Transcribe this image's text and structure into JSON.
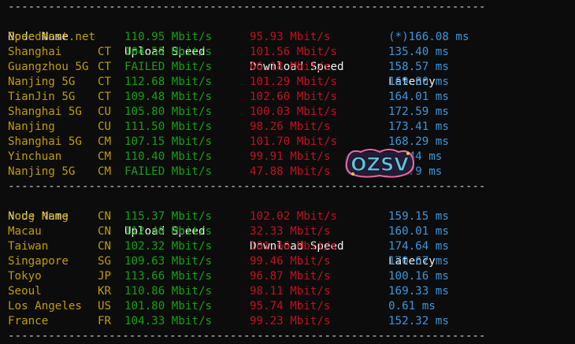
{
  "divider": "------------------------------------------------------------------------------------------",
  "headers": {
    "node": "Node Name",
    "upload": "Upload Speed",
    "download": "Download Speed",
    "latency": "Latency"
  },
  "table1": [
    {
      "node": "Speedtest.net",
      "isp": "",
      "up": "110.95 Mbit/s",
      "down": "95.93 Mbit/s",
      "lat": "(*)166.08 ms"
    },
    {
      "node": "Shanghai",
      "isp": "CT",
      "up": "104.58 Mbit/s",
      "down": "101.56 Mbit/s",
      "lat": "135.40 ms"
    },
    {
      "node": "Guangzhou 5G",
      "isp": "CT",
      "up": "FAILED Mbit/s",
      "down": "66.18 Mbit/s",
      "lat": "158.57 ms"
    },
    {
      "node": "Nanjing 5G",
      "isp": "CT",
      "up": "112.68 Mbit/s",
      "down": "101.29 Mbit/s",
      "lat": "169.80 ms"
    },
    {
      "node": "TianJin 5G",
      "isp": "CT",
      "up": "109.48 Mbit/s",
      "down": "102.60 Mbit/s",
      "lat": "164.01 ms"
    },
    {
      "node": "Shanghai 5G",
      "isp": "CU",
      "up": "105.80 Mbit/s",
      "down": "100.03 Mbit/s",
      "lat": "172.59 ms"
    },
    {
      "node": "Nanjing",
      "isp": "CU",
      "up": "111.50 Mbit/s",
      "down": "98.26 Mbit/s",
      "lat": "173.41 ms"
    },
    {
      "node": "Shanghai 5G",
      "isp": "CM",
      "up": "107.15 Mbit/s",
      "down": "101.70 Mbit/s",
      "lat": "168.29 ms"
    },
    {
      "node": "Yinchuan",
      "isp": "CM",
      "up": "110.40 Mbit/s",
      "down": "99.91 Mbit/s",
      "lat": "   44 ms"
    },
    {
      "node": "Nanjing 5G",
      "isp": "CM",
      "up": "FAILED Mbit/s",
      "down": "47.88 Mbit/s",
      "lat": "   79 ms"
    }
  ],
  "table2": [
    {
      "node": "Hong Kong",
      "isp": "CN",
      "up": "115.37 Mbit/s",
      "down": "102.02 Mbit/s",
      "lat": "159.15 ms"
    },
    {
      "node": "Macau",
      "isp": "CN",
      "up": "112.40 Mbit/s",
      "down": "32.33 Mbit/s",
      "lat": "160.01 ms"
    },
    {
      "node": "Taiwan",
      "isp": "CN",
      "up": "102.32 Mbit/s",
      "down": "101.66 Mbit/s",
      "lat": "174.64 ms"
    },
    {
      "node": "Singapore",
      "isp": "SG",
      "up": "109.63 Mbit/s",
      "down": "99.46 Mbit/s",
      "lat": "170.67 ms"
    },
    {
      "node": "Tokyo",
      "isp": "JP",
      "up": "113.66 Mbit/s",
      "down": "96.87 Mbit/s",
      "lat": "100.16 ms"
    },
    {
      "node": "Seoul",
      "isp": "KR",
      "up": "110.86 Mbit/s",
      "down": "98.11 Mbit/s",
      "lat": "169.33 ms"
    },
    {
      "node": "Los Angeles",
      "isp": "US",
      "up": "101.80 Mbit/s",
      "down": "95.74 Mbit/s",
      "lat": "0.61 ms"
    },
    {
      "node": "France",
      "isp": "FR",
      "up": "104.33 Mbit/s",
      "down": "99.23 Mbit/s",
      "lat": "152.32 ms"
    }
  ],
  "watermark": {
    "text": "OZSV",
    "colors": [
      "#f2c14e",
      "#5ec7d6",
      "#e86aa6",
      "#7b4fc9"
    ]
  },
  "colors": {
    "background": "#0c0c0c",
    "text": "#cccccc",
    "node": "#c19c00",
    "upload": "#13a10e",
    "download": "#c50f1f",
    "latency": "#3a96dd"
  }
}
